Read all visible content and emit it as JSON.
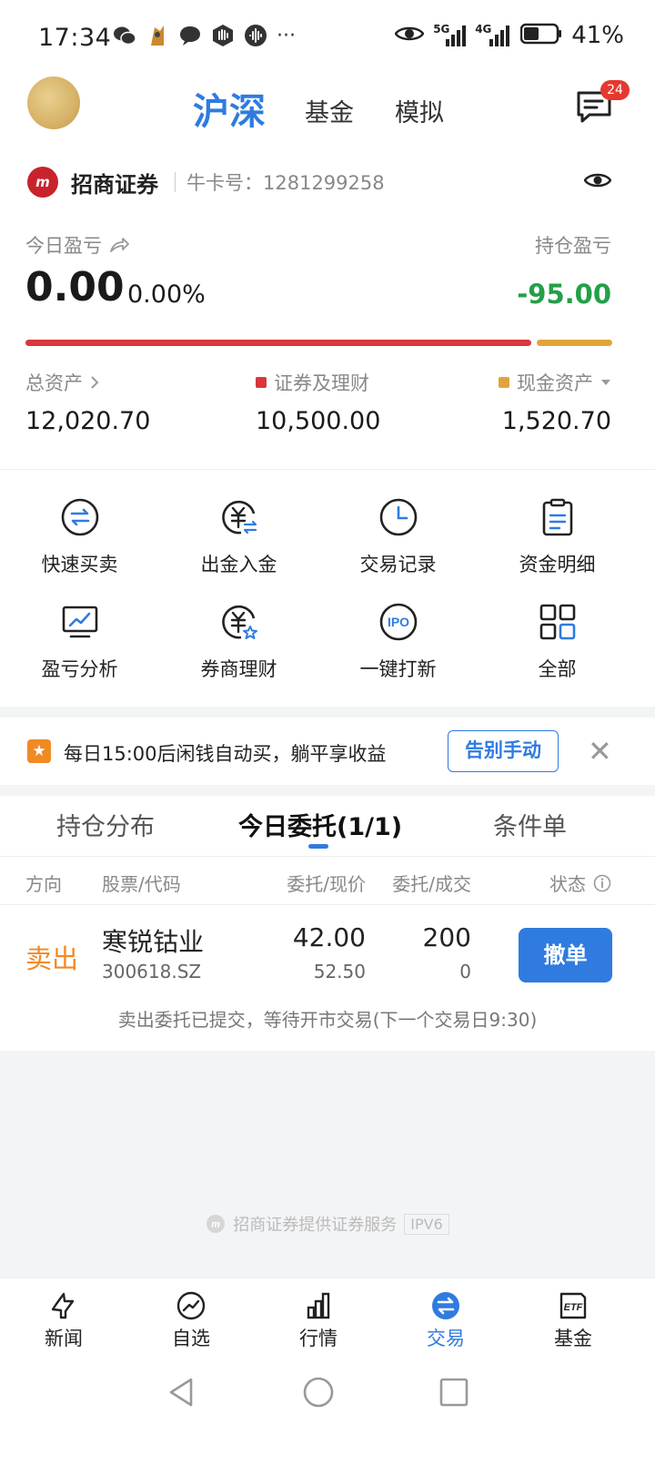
{
  "status_bar": {
    "time": "17:34",
    "network_1": "5G",
    "network_2": "4G",
    "battery": "41%",
    "more": "···"
  },
  "header": {
    "tabs": [
      "沪深",
      "基金",
      "模拟"
    ],
    "active_tab": "沪深",
    "message_badge": "24",
    "accent": "#2f7be0"
  },
  "broker": {
    "logo_text": "m",
    "name": "招商证券",
    "account_label": "牛卡号：1281299258"
  },
  "pnl": {
    "today_label": "今日盈亏",
    "today_value": "0.00",
    "today_pct": "0.00%",
    "hold_label": "持仓盈亏",
    "hold_value": "-95.00",
    "hold_color": "#22a047"
  },
  "assets": {
    "total_label": "总资产",
    "total_value": "12,020.70",
    "securities_label": "证券及理财",
    "securities_value": "10,500.00",
    "cash_label": "现金资产",
    "cash_value": "1,520.70",
    "securities_color": "#d9363e",
    "cash_color": "#e0a43a"
  },
  "grid": [
    {
      "label": "快速买卖",
      "icon": "quick-trade-icon"
    },
    {
      "label": "出金入金",
      "icon": "transfer-funds-icon"
    },
    {
      "label": "交易记录",
      "icon": "clock-icon"
    },
    {
      "label": "资金明细",
      "icon": "clipboard-icon"
    },
    {
      "label": "盈亏分析",
      "icon": "chart-monitor-icon"
    },
    {
      "label": "券商理财",
      "icon": "yuan-star-icon"
    },
    {
      "label": "一键打新",
      "icon": "ipo-icon"
    },
    {
      "label": "全部",
      "icon": "grid-icon"
    }
  ],
  "banner": {
    "text": "每日15:00后闲钱自动买，躺平享收益",
    "button": "告别手动"
  },
  "order_tabs": [
    "持仓分布",
    "今日委托(1/1)",
    "条件单"
  ],
  "table_headers": {
    "direction": "方向",
    "stock": "股票/代码",
    "price": "委托/现价",
    "qty": "委托/成交",
    "status": "状态"
  },
  "order": {
    "direction": "卖出",
    "name": "寒锐钴业",
    "code": "300618.SZ",
    "order_price": "42.00",
    "current_price": "52.50",
    "order_qty": "200",
    "filled_qty": "0",
    "cancel_button": "撤单",
    "note": "卖出委托已提交，等待开市交易(下一个交易日9:30)"
  },
  "footer": {
    "text": "招商证券提供证券服务",
    "ipv6": "IPV6"
  },
  "bottom_nav": [
    {
      "label": "新闻",
      "icon": "news-icon"
    },
    {
      "label": "自选",
      "icon": "watchlist-icon"
    },
    {
      "label": "行情",
      "icon": "market-icon"
    },
    {
      "label": "交易",
      "icon": "trade-icon",
      "active": true
    },
    {
      "label": "基金",
      "icon": "etf-icon"
    }
  ]
}
